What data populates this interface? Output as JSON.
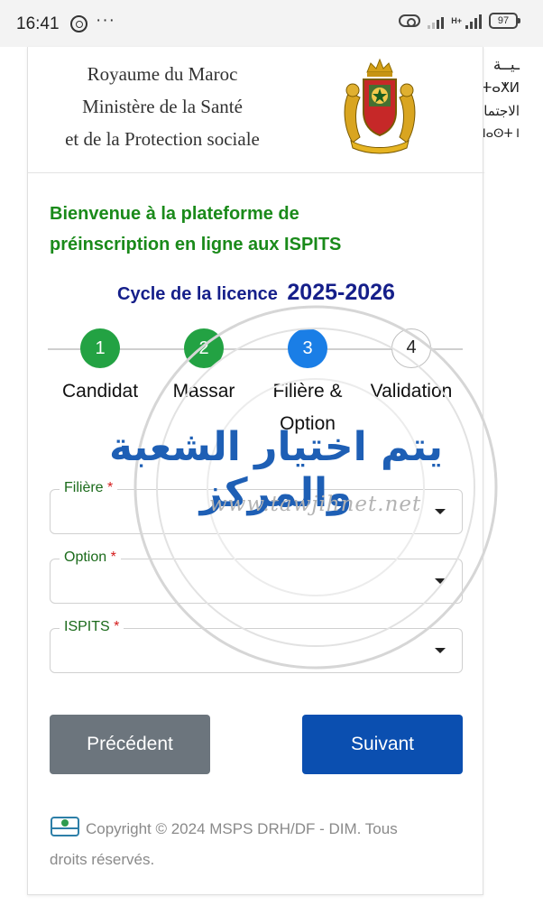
{
  "status_bar": {
    "time": "16:41",
    "dots": "···",
    "network_type": "H+",
    "battery": "97"
  },
  "header": {
    "ministry_line1": "Royaume du Maroc",
    "ministry_line2": "Ministère de la Santé",
    "ministry_line3": "et de la Protection sociale",
    "arabic_line1": "ـيــة",
    "arabic_line2": "ⵜⴰⵅⵍ",
    "arabic_line3": "الاجتماعية",
    "arabic_line4": "ⵜⴰⵎⴰⵡⴰⵙⵜ ⵏ"
  },
  "welcome": {
    "line1": "Bienvenue à la plateforme de",
    "line2": "préinscription en ligne aux ISPITS"
  },
  "cycle": {
    "label": "Cycle de la licence",
    "year": "2025-2026"
  },
  "steps": [
    {
      "number": "1",
      "label": "Candidat",
      "state": "done"
    },
    {
      "number": "2",
      "label": "Massar",
      "state": "done"
    },
    {
      "number": "3",
      "label": "Filière & Option",
      "state": "active"
    },
    {
      "number": "4",
      "label": "Validation",
      "state": "pending"
    }
  ],
  "form": {
    "filiere_label": "Filière",
    "option_label": "Option",
    "ispits_label": "ISPITS",
    "required_mark": "*",
    "filiere_value": "",
    "option_value": "",
    "ispits_value": ""
  },
  "buttons": {
    "prev_label": "Précédent",
    "next_label": "Suivant"
  },
  "footer": {
    "copyright_line1": "Copyright © 2024 MSPS DRH/DF - DIM. Tous",
    "copyright_line2": "droits réservés."
  },
  "watermark": {
    "arabic_text": "يتم اختيار الشعبة والمركز",
    "url": "www.tawjihnet.net"
  },
  "colors": {
    "green": "#1a8a1a",
    "step_done": "#23a243",
    "step_active": "#1a7ee6",
    "cycle_blue": "#151f8a",
    "btn_prev": "#6c757d",
    "btn_next": "#0b4fb0",
    "watermark_blue": "#1e5fb5"
  }
}
